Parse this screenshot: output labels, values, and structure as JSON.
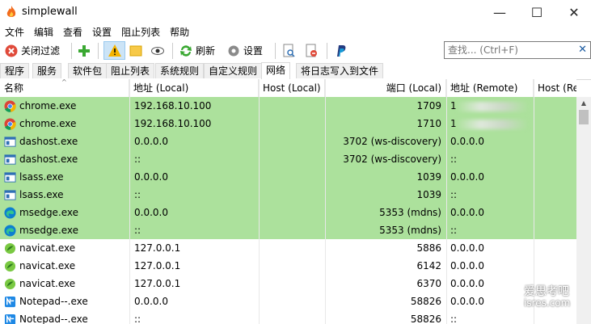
{
  "window": {
    "title": "simplewall",
    "minimize": "—",
    "maximize": "☐",
    "close": "✕"
  },
  "menu": [
    "文件",
    "编辑",
    "查看",
    "设置",
    "阻止列表",
    "帮助"
  ],
  "toolbar": {
    "disable_filter": "关闭过滤",
    "refresh": "刷新",
    "settings": "设置"
  },
  "search": {
    "placeholder": "查找... (Ctrl+F)",
    "clear": "✕"
  },
  "tabs": [
    "程序",
    "服务",
    "软件包",
    "阻止列表",
    "系统规则",
    "自定义规则",
    "网络",
    "将日志写入到文件"
  ],
  "active_tab": "网络",
  "columns": [
    "名称",
    "地址 (Local)",
    "Host (Local)",
    "端口 (Local)",
    "地址 (Remote)",
    "Host (Re"
  ],
  "rows": [
    {
      "name": "chrome.exe",
      "icon": "chrome-icon",
      "laddr": "192.168.10.100",
      "lport": "1709",
      "raddr": "1",
      "highlight": true
    },
    {
      "name": "chrome.exe",
      "icon": "chrome-icon",
      "laddr": "192.168.10.100",
      "lport": "1710",
      "raddr": "1",
      "highlight": true
    },
    {
      "name": "dashost.exe",
      "icon": "window-app-icon",
      "laddr": "0.0.0.0",
      "lport": "3702 (ws-discovery)",
      "raddr": "0.0.0.0",
      "highlight": true
    },
    {
      "name": "dashost.exe",
      "icon": "window-app-icon",
      "laddr": "::",
      "lport": "3702 (ws-discovery)",
      "raddr": "::",
      "highlight": true
    },
    {
      "name": "lsass.exe",
      "icon": "window-app-icon",
      "laddr": "0.0.0.0",
      "lport": "1039",
      "raddr": "0.0.0.0",
      "highlight": true
    },
    {
      "name": "lsass.exe",
      "icon": "window-app-icon",
      "laddr": "::",
      "lport": "1039",
      "raddr": "::",
      "highlight": true
    },
    {
      "name": "msedge.exe",
      "icon": "edge-icon",
      "laddr": "0.0.0.0",
      "lport": "5353 (mdns)",
      "raddr": "0.0.0.0",
      "highlight": true
    },
    {
      "name": "msedge.exe",
      "icon": "edge-icon",
      "laddr": "::",
      "lport": "5353 (mdns)",
      "raddr": "::",
      "highlight": true
    },
    {
      "name": "navicat.exe",
      "icon": "navicat-icon",
      "laddr": "127.0.0.1",
      "lport": "5886",
      "raddr": "0.0.0.0",
      "highlight": false
    },
    {
      "name": "navicat.exe",
      "icon": "navicat-icon",
      "laddr": "127.0.0.1",
      "lport": "6142",
      "raddr": "0.0.0.0",
      "highlight": false
    },
    {
      "name": "navicat.exe",
      "icon": "navicat-icon",
      "laddr": "127.0.0.1",
      "lport": "6370",
      "raddr": "0.0.0.0",
      "highlight": false
    },
    {
      "name": "Notepad--.exe",
      "icon": "notepad-icon",
      "laddr": "0.0.0.0",
      "lport": "58826",
      "raddr": "0.0.0.0",
      "highlight": false
    },
    {
      "name": "Notepad--.exe",
      "icon": "notepad-icon",
      "laddr": "::",
      "lport": "58826",
      "raddr": "::",
      "highlight": false
    }
  ],
  "watermark": {
    "line1": "爱思考吧",
    "line2": "isres.com"
  },
  "colors": {
    "highlight_row": "#ace19c",
    "tab_border": "#d9d9d9"
  }
}
